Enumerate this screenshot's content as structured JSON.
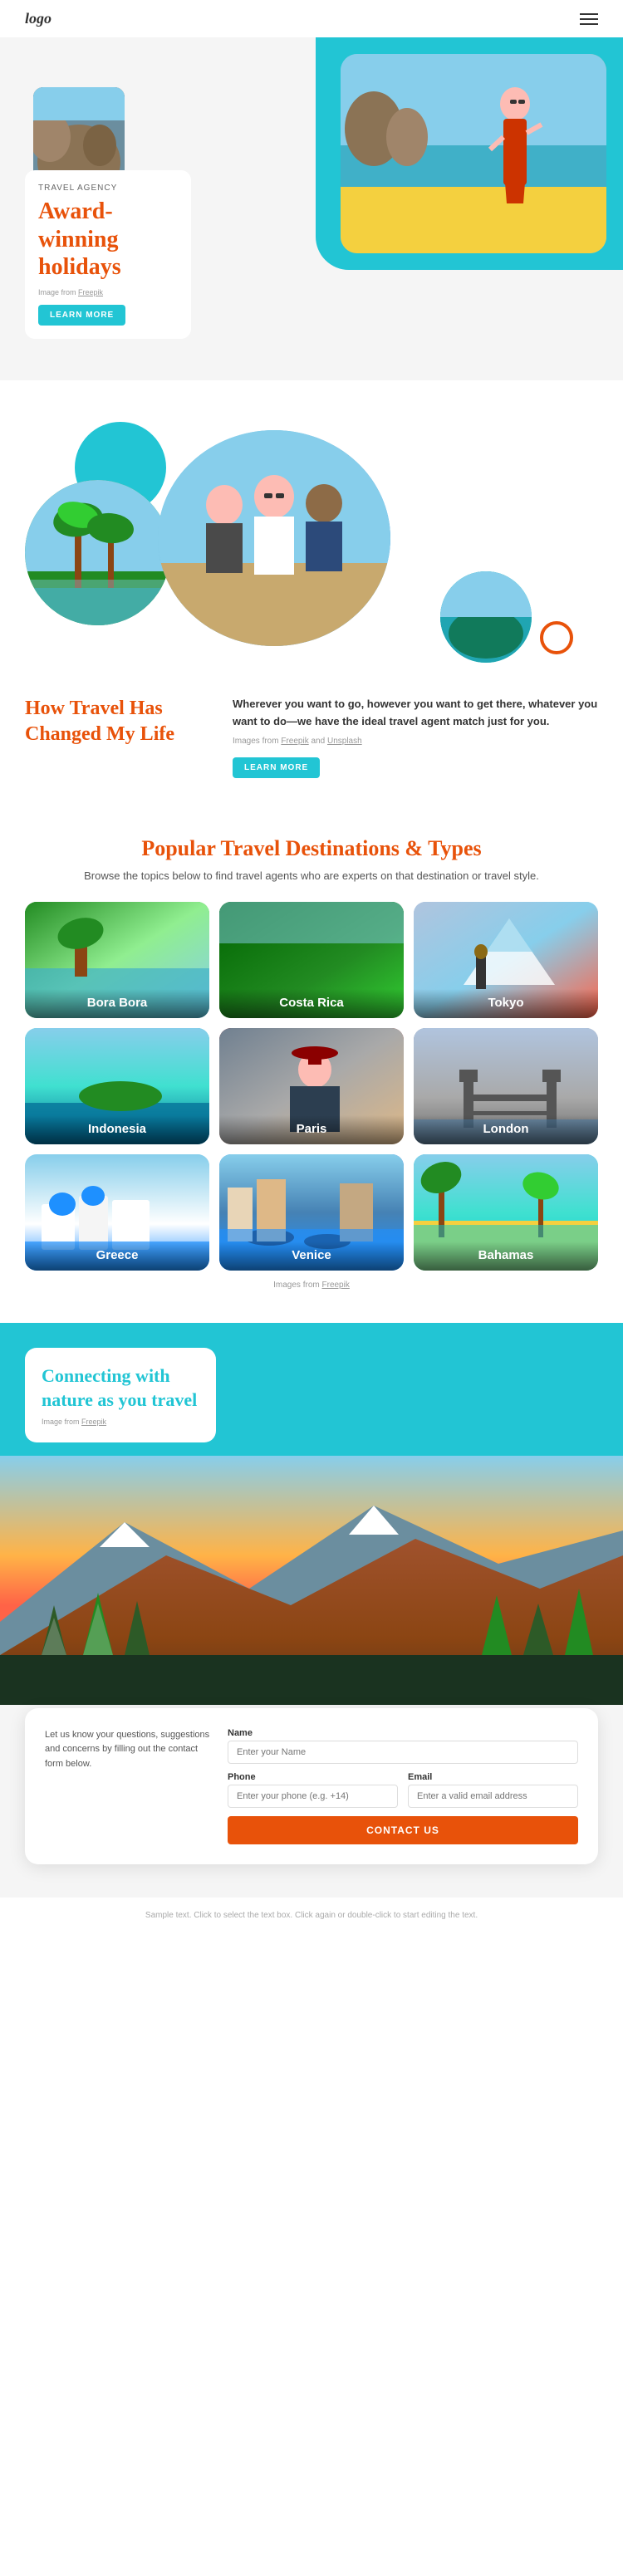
{
  "header": {
    "logo": "logo",
    "menu_icon": "≡"
  },
  "hero": {
    "eyebrow": "TRAVEL AGENCY",
    "title": "Award-winning holidays",
    "credit_prefix": "Image from ",
    "credit_link": "Freepik",
    "btn_label": "LEARN MORE"
  },
  "how_travel": {
    "title": "How Travel Has Changed My Life",
    "description": "Wherever you want to go, however you want to get there, whatever you want to do—we have the ideal travel agent match just for you.",
    "credit_prefix": "Images from ",
    "credit_link1": "Freepik",
    "credit_and": " and ",
    "credit_link2": "Unsplash",
    "btn_label": "LEARN MORE"
  },
  "destinations": {
    "title": "Popular Travel Destinations & Types",
    "description": "Browse the topics below to find travel agents who are experts on that destination or travel style.",
    "credit_prefix": "Images from ",
    "credit_link": "Freepik",
    "items": [
      {
        "id": "borabora",
        "label": "Bora Bora"
      },
      {
        "id": "costarica",
        "label": "Costa Rica"
      },
      {
        "id": "tokyo",
        "label": "Tokyo"
      },
      {
        "id": "indonesia",
        "label": "Indonesia"
      },
      {
        "id": "paris",
        "label": "Paris"
      },
      {
        "id": "london",
        "label": "London"
      },
      {
        "id": "greece",
        "label": "Greece"
      },
      {
        "id": "venice",
        "label": "Venice"
      },
      {
        "id": "bahamas",
        "label": "Bahamas"
      }
    ]
  },
  "nature": {
    "title": "Connecting with nature as you travel",
    "credit_prefix": "Image from ",
    "credit_link": "Freepik"
  },
  "contact": {
    "left_text": "Let us know your questions, suggestions and concerns by filling out the contact form below.",
    "name_label": "Name",
    "name_placeholder": "Enter your Name",
    "phone_label": "Phone",
    "phone_placeholder": "Enter your phone (e.g. +14)",
    "email_label": "Email",
    "email_placeholder": "Enter a valid email address",
    "btn_label": "CONTACT US"
  },
  "footer": {
    "text": "Sample text. Click to select the text box. Click again or double-click to start editing the text."
  },
  "colors": {
    "teal": "#22c5d4",
    "orange": "#e8520a",
    "dark": "#333333",
    "light_gray": "#f5f5f5"
  }
}
